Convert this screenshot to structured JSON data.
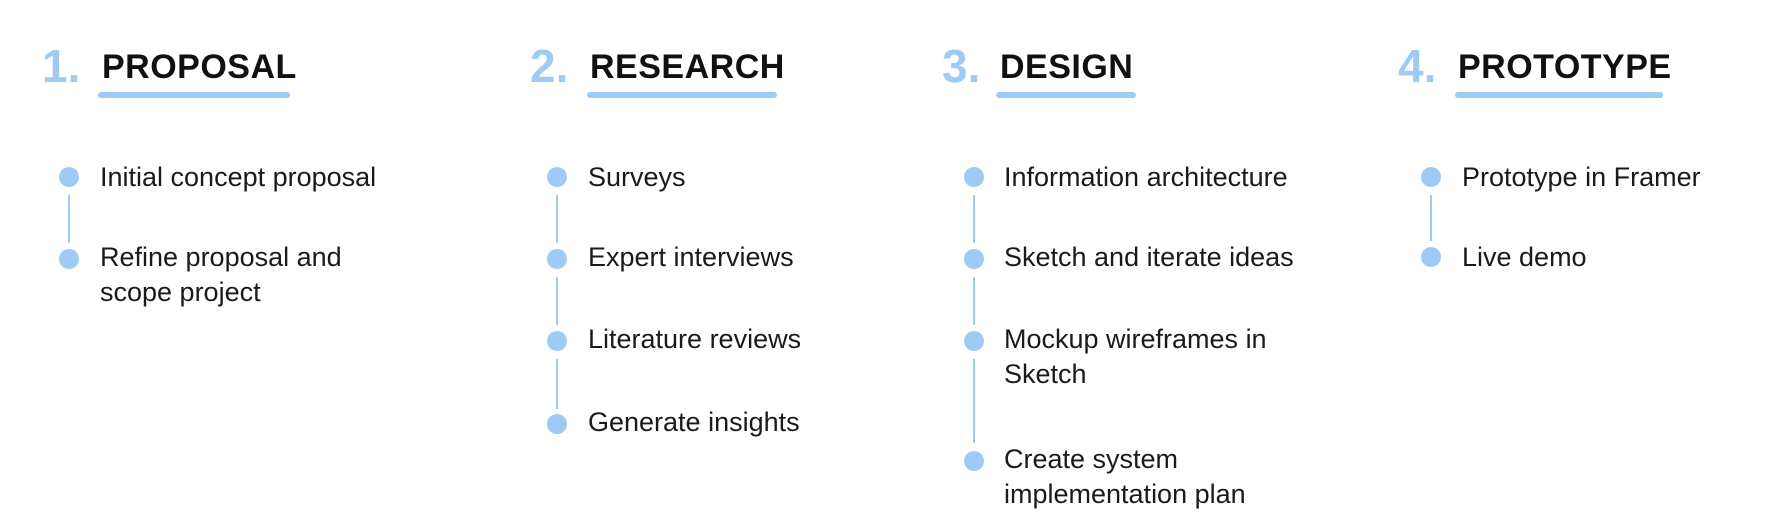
{
  "accent_color": "#9ecbf4",
  "phases": [
    {
      "number": "1.",
      "title": "PROPOSAL",
      "steps": [
        "Initial concept proposal",
        "Refine proposal and scope project"
      ]
    },
    {
      "number": "2.",
      "title": "RESEARCH",
      "steps": [
        "Surveys",
        "Expert interviews",
        "Literature reviews",
        "Generate insights"
      ]
    },
    {
      "number": "3.",
      "title": "DESIGN",
      "steps": [
        "Information architecture",
        "Sketch and iterate ideas",
        "Mockup wireframes in Sketch",
        "Create system implementation plan"
      ]
    },
    {
      "number": "4.",
      "title": "PROTOTYPE",
      "steps": [
        "Prototype in Framer",
        "Live demo"
      ]
    }
  ]
}
